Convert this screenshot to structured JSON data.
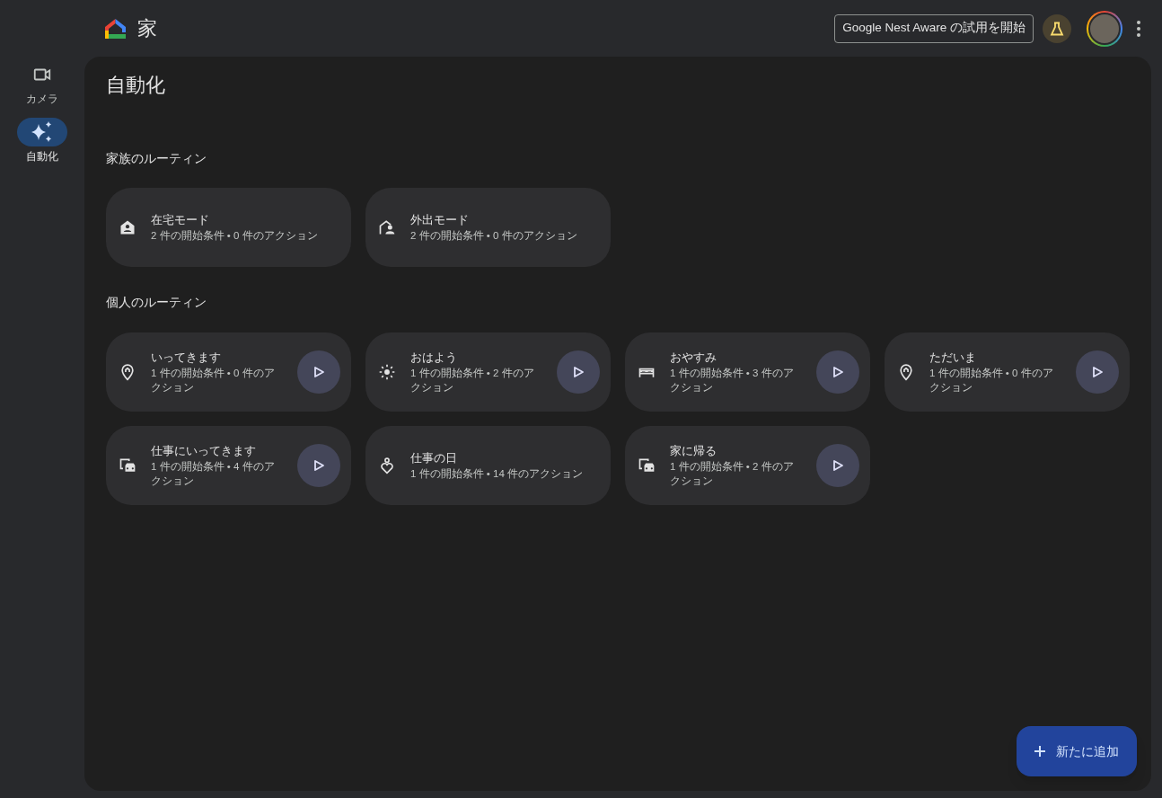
{
  "header": {
    "title": "家",
    "trial_button": "Google Nest Aware の試用を開始"
  },
  "sidebar": {
    "items": [
      {
        "label": "カメラ",
        "kind": "camera",
        "selected": false
      },
      {
        "label": "自動化",
        "kind": "sparkle",
        "selected": true
      }
    ]
  },
  "page": {
    "title": "自動化"
  },
  "sections": [
    {
      "heading": "家族のルーティン",
      "routines": [
        {
          "name": "在宅モード",
          "detail": "2 件の開始条件 • 0 件のアクション",
          "kind": "home-person",
          "playable": false
        },
        {
          "name": "外出モード",
          "detail": "2 件の開始条件 • 0 件のアクション",
          "kind": "away-person",
          "playable": false
        }
      ]
    },
    {
      "heading": "個人のルーティン",
      "routines": [
        {
          "name": "いってきます",
          "detail": "1 件の開始条件 • 0 件のアクション",
          "kind": "pin",
          "playable": true
        },
        {
          "name": "おはよう",
          "detail": "1 件の開始条件 • 2 件のアクション",
          "kind": "sun",
          "playable": true
        },
        {
          "name": "おやすみ",
          "detail": "1 件の開始条件 • 3 件のアクション",
          "kind": "bed",
          "playable": true
        },
        {
          "name": "ただいま",
          "detail": "1 件の開始条件 • 0 件のアクション",
          "kind": "pin",
          "playable": true
        },
        {
          "name": "仕事にいってきます",
          "detail": "1 件の開始条件 • 4 件のアクション",
          "kind": "commute",
          "playable": true
        },
        {
          "name": "仕事の日",
          "detail": "1 件の開始条件 • 14 件のアクション",
          "kind": "heart-person",
          "playable": false
        },
        {
          "name": "家に帰る",
          "detail": "1 件の開始条件 • 2 件のアクション",
          "kind": "commute",
          "playable": true
        }
      ]
    }
  ],
  "fab": {
    "label": "新たに追加"
  }
}
